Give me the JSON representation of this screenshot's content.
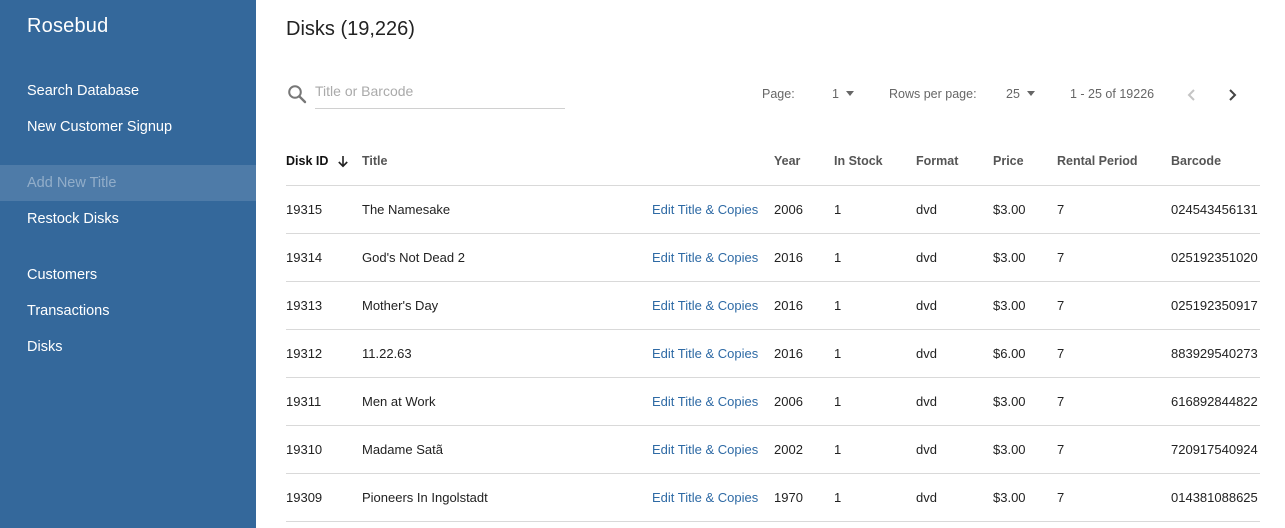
{
  "app": {
    "brand": "Rosebud"
  },
  "sidebar": {
    "items": [
      {
        "label": "Search Database",
        "active": false
      },
      {
        "label": "New Customer Signup",
        "active": false
      },
      {
        "label": "Add New Title",
        "active": true
      },
      {
        "label": "Restock Disks",
        "active": false
      },
      {
        "label": "Customers",
        "active": false
      },
      {
        "label": "Transactions",
        "active": false
      },
      {
        "label": "Disks",
        "active": false
      }
    ]
  },
  "main": {
    "title": "Disks (19,226)",
    "search": {
      "placeholder": "Title or Barcode",
      "value": ""
    },
    "pagination": {
      "page_label": "Page:",
      "page_value": "1",
      "rows_label": "Rows per page:",
      "rows_value": "25",
      "range_text": "1 - 25 of 19226"
    },
    "table": {
      "columns": {
        "disk_id": "Disk ID",
        "title": "Title",
        "year": "Year",
        "in_stock": "In Stock",
        "format": "Format",
        "price": "Price",
        "rental_period": "Rental Period",
        "barcode": "Barcode"
      },
      "edit_link_label": "Edit Title & Copies",
      "rows": [
        {
          "disk_id": "19315",
          "title": "The Namesake",
          "year": "2006",
          "in_stock": "1",
          "format": "dvd",
          "price": "$3.00",
          "rental_period": "7",
          "barcode": "024543456131"
        },
        {
          "disk_id": "19314",
          "title": "God's Not Dead 2",
          "year": "2016",
          "in_stock": "1",
          "format": "dvd",
          "price": "$3.00",
          "rental_period": "7",
          "barcode": "025192351020"
        },
        {
          "disk_id": "19313",
          "title": "Mother's Day",
          "year": "2016",
          "in_stock": "1",
          "format": "dvd",
          "price": "$3.00",
          "rental_period": "7",
          "barcode": "025192350917"
        },
        {
          "disk_id": "19312",
          "title": "11.22.63",
          "year": "2016",
          "in_stock": "1",
          "format": "dvd",
          "price": "$6.00",
          "rental_period": "7",
          "barcode": "883929540273"
        },
        {
          "disk_id": "19311",
          "title": "Men at Work",
          "year": "2006",
          "in_stock": "1",
          "format": "dvd",
          "price": "$3.00",
          "rental_period": "7",
          "barcode": "616892844822"
        },
        {
          "disk_id": "19310",
          "title": "Madame Satã",
          "year": "2002",
          "in_stock": "1",
          "format": "dvd",
          "price": "$3.00",
          "rental_period": "7",
          "barcode": "720917540924"
        },
        {
          "disk_id": "19309",
          "title": "Pioneers In Ingolstadt",
          "year": "1970",
          "in_stock": "1",
          "format": "dvd",
          "price": "$3.00",
          "rental_period": "7",
          "barcode": "014381088625"
        }
      ]
    }
  },
  "colors": {
    "sidebar": "#34689b",
    "link": "#2e6aa5"
  },
  "icons": {
    "search": "search-icon",
    "sort": "arrow-down-icon",
    "prev": "chevron-left-icon",
    "next": "chevron-right-icon"
  }
}
